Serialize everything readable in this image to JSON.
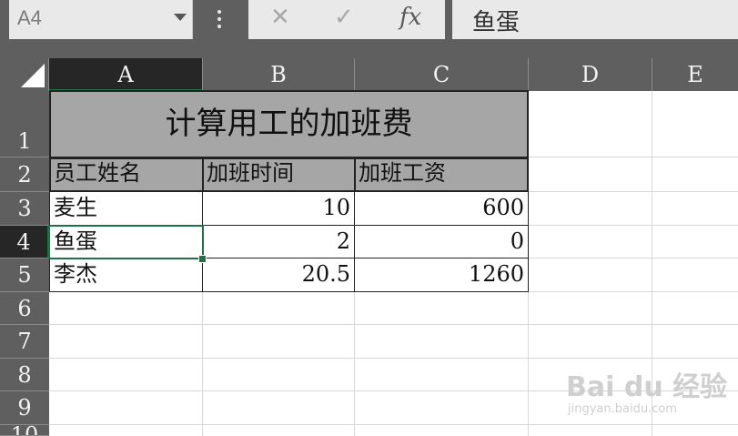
{
  "formula_bar": {
    "name_box": "A4",
    "cancel_icon": "✕",
    "enter_icon": "✓",
    "fx_label": "fx",
    "formula_value": "鱼蛋"
  },
  "columns": [
    "A",
    "B",
    "C",
    "D",
    "E"
  ],
  "rows": [
    "1",
    "2",
    "3",
    "4",
    "5",
    "6",
    "7",
    "8",
    "9",
    "10"
  ],
  "sheet": {
    "title": "计算用工的加班费",
    "headers": [
      "员工姓名",
      "加班时间",
      "加班工资"
    ],
    "records": [
      [
        "麦生",
        "10",
        "600"
      ],
      [
        "鱼蛋",
        "2",
        "0"
      ],
      [
        "李杰",
        "20.5",
        "1260"
      ]
    ]
  },
  "watermark": {
    "brand": "Bai du 经验",
    "url": "jingyan.baidu.com"
  },
  "colors": {
    "chrome": "#5f5f5f",
    "selected_header": "#262626",
    "selection": "#1e7145",
    "header_fill": "#a6a6a6"
  }
}
